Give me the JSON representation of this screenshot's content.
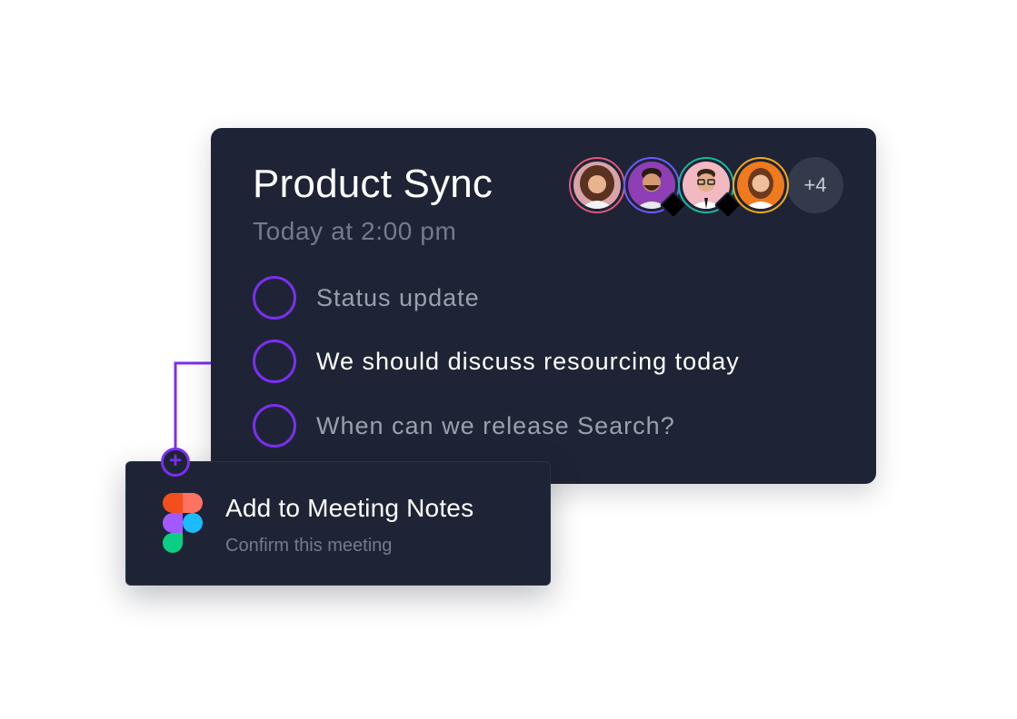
{
  "meeting": {
    "title": "Product Sync",
    "time": "Today at 2:00 pm",
    "attendees": [
      {
        "icon": "avatar-woman-curly-hair",
        "ring": "#e0577a",
        "bg": "#d9a3a8",
        "has_badge": false
      },
      {
        "icon": "avatar-man-beard",
        "ring": "#6b5cff",
        "bg": "#8e3fb5",
        "has_badge": true
      },
      {
        "icon": "avatar-man-glasses",
        "ring": "#18b8a0",
        "bg": "#f2b9c2",
        "has_badge": true
      },
      {
        "icon": "avatar-woman-smiling",
        "ring": "#f2a81c",
        "bg": "#f07a1d",
        "has_badge": false
      }
    ],
    "more_attendees": "+4",
    "agenda": [
      {
        "label": "Status update",
        "active": false
      },
      {
        "label": "We should discuss resourcing today",
        "active": true
      },
      {
        "label": "When can we release Search?",
        "active": false
      }
    ]
  },
  "action": {
    "app_icon": "figma-icon",
    "title": "Add to Meeting Notes",
    "subtitle": "Confirm this meeting",
    "add_icon": "plus-icon"
  },
  "colors": {
    "card_bg": "#1e2435",
    "accent": "#7b2ff0",
    "muted_text": "#737b8c",
    "figma_red": "#f24e1e",
    "figma_salmon": "#ff7262",
    "figma_purple": "#a259ff",
    "figma_blue": "#1abcfe",
    "figma_green": "#0acf83"
  }
}
